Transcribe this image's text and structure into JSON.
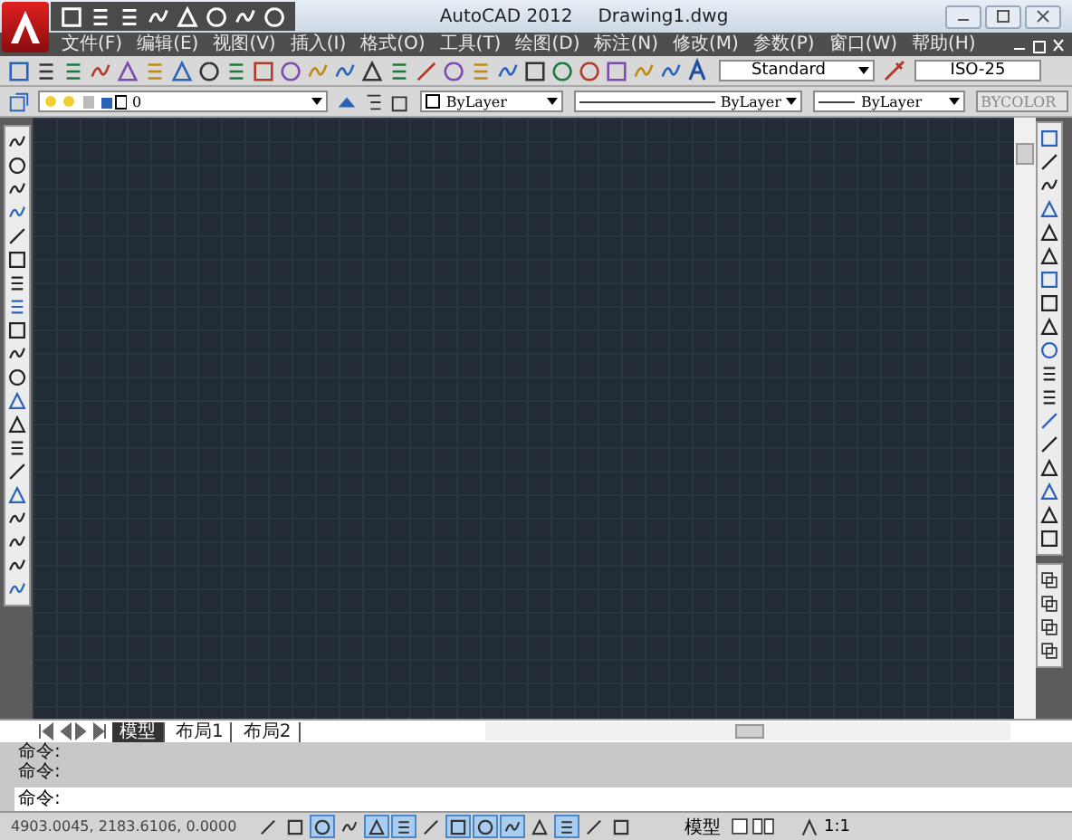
{
  "window": {
    "app_title": "AutoCAD 2012",
    "file_title": "Drawing1.dwg"
  },
  "menu": [
    "文件(F)",
    "编辑(E)",
    "视图(V)",
    "插入(I)",
    "格式(O)",
    "工具(T)",
    "绘图(D)",
    "标注(N)",
    "修改(M)",
    "参数(P)",
    "窗口(W)",
    "帮助(H)"
  ],
  "styles_toolbar": {
    "text_style": "Standard",
    "dimension_style": "ISO-25"
  },
  "layers_toolbar": {
    "layer": "0",
    "color_control": "ByLayer",
    "linetype": "ByLayer",
    "lineweight": "ByLayer",
    "plot_style": "BYCOLOR"
  },
  "layout_tabs": [
    {
      "label": "模型",
      "selected": true
    },
    {
      "label": "布局1",
      "selected": false
    },
    {
      "label": "布局2",
      "selected": false
    }
  ],
  "command_history": [
    "命令:",
    "命令:"
  ],
  "command_prompt": "命令:",
  "status_bar": {
    "coordinates": "4903.0045, 2183.6106, 0.0000",
    "toggles": [
      {
        "on": false
      },
      {
        "on": false
      },
      {
        "on": true
      },
      {
        "on": false
      },
      {
        "on": true
      },
      {
        "on": true
      },
      {
        "on": false
      },
      {
        "on": true
      },
      {
        "on": true
      },
      {
        "on": true
      },
      {
        "on": false
      },
      {
        "on": true
      },
      {
        "on": false
      },
      {
        "on": false
      }
    ],
    "space": "模型",
    "scale": "1:1"
  }
}
